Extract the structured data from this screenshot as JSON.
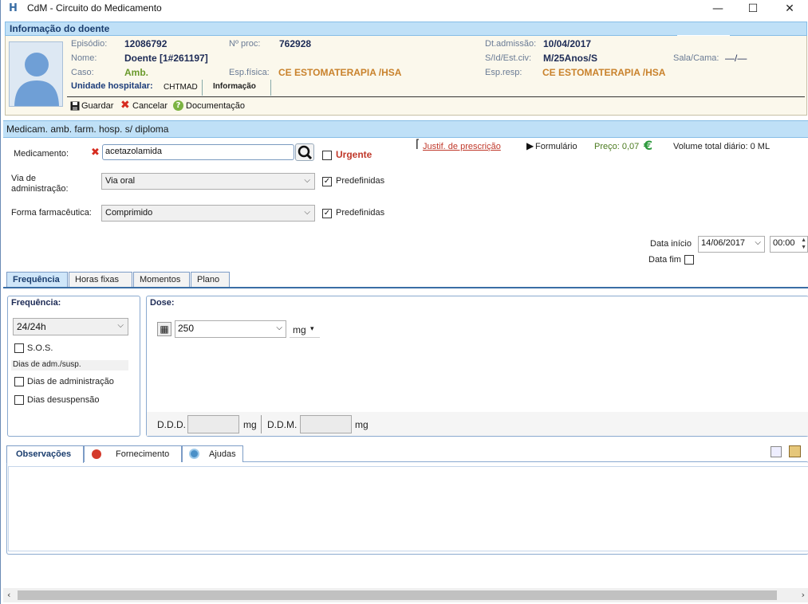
{
  "window": {
    "title": "CdM - Circuito do Medicamento",
    "app_icon": "H",
    "buttons": {
      "minimize": "—",
      "maximize": "☐",
      "close": "✕"
    }
  },
  "patient": {
    "header": "Informação do doente",
    "avatar_icon": "person-silhouette-icon",
    "fields": {
      "episodio_label": "Episódio:",
      "episodio_value": "12086792",
      "nproc_label": "Nº proc:",
      "nproc_value": "762928",
      "dtadm_label": "Dt.admissão:",
      "dtadm_value": "10/04/2017",
      "nome_label": "Nome:",
      "nome_value": "Doente [1#261197]",
      "sid_label": "S/Id/Est.civ:",
      "sid_value": "M/25Anos/S",
      "sala_label": "Sala/Cama:",
      "sala_value": "—/—",
      "caso_label": "Caso:",
      "caso_value": "Amb.",
      "espfis_label": "Esp.física:",
      "espfis_value": "CE ESTOMATERAPIA /HSA",
      "espresp_label": "Esp.resp:",
      "espresp_value": "CE ESTOMATERAPIA /HSA",
      "unidade_label": "Unidade hospitalar:",
      "unidade_value": "CHTMAD",
      "informacao_tab": "Informação"
    },
    "toolbar": {
      "guardar": "Guardar",
      "cancelar": "Cancelar",
      "documentacao": "Documentação"
    }
  },
  "section": {
    "title": "Medicam. amb. farm. hosp. s/ diploma"
  },
  "form": {
    "medicamento_label": "Medicamento:",
    "medicamento_value": "acetazolamida",
    "urgente_label": "Urgente",
    "justif_link": "Justif. de prescrição",
    "formulario_label": "Formulário",
    "preco_label": "Preço: 0,07",
    "euro_symbol": "€",
    "volume_label": "Volume total diário: 0 ML",
    "via_label_1": "Via de",
    "via_label_2": "administração:",
    "via_value": "Via oral",
    "predefinidas_1": "Predefinidas",
    "forma_label": "Forma farmacêutica:",
    "forma_value": "Comprimido",
    "predefinidas_2": "Predefinidas",
    "data_inicio_label": "Data início",
    "data_inicio_value": "14/06/2017",
    "hora_value": "00:00",
    "data_fim_label": "Data fim"
  },
  "tabs": [
    "Frequência",
    "Horas fixas",
    "Momentos",
    "Plano"
  ],
  "frequencia": {
    "title": "Frequência:",
    "value": "24/24h",
    "sos_label": "S.O.S.",
    "dias_header": "Dias de adm./susp.",
    "dias_admin": "Dias de administração",
    "dias_susp": "Dias desuspensão"
  },
  "dose": {
    "title": "Dose:",
    "value": "250",
    "unit": "mg",
    "unit_caret": "▾",
    "ddd_label": "D.D.D.",
    "ddd_unit": "mg",
    "ddm_label": "D.D.M.",
    "ddm_unit": "mg"
  },
  "bottom_tabs": [
    "Observações",
    "Fornecimento",
    "Ajudas"
  ],
  "colors": {
    "accent": "#3a6ea5",
    "header_bg": "#bfe0f7",
    "orange": "#c9822c",
    "red": "#c0392b"
  }
}
